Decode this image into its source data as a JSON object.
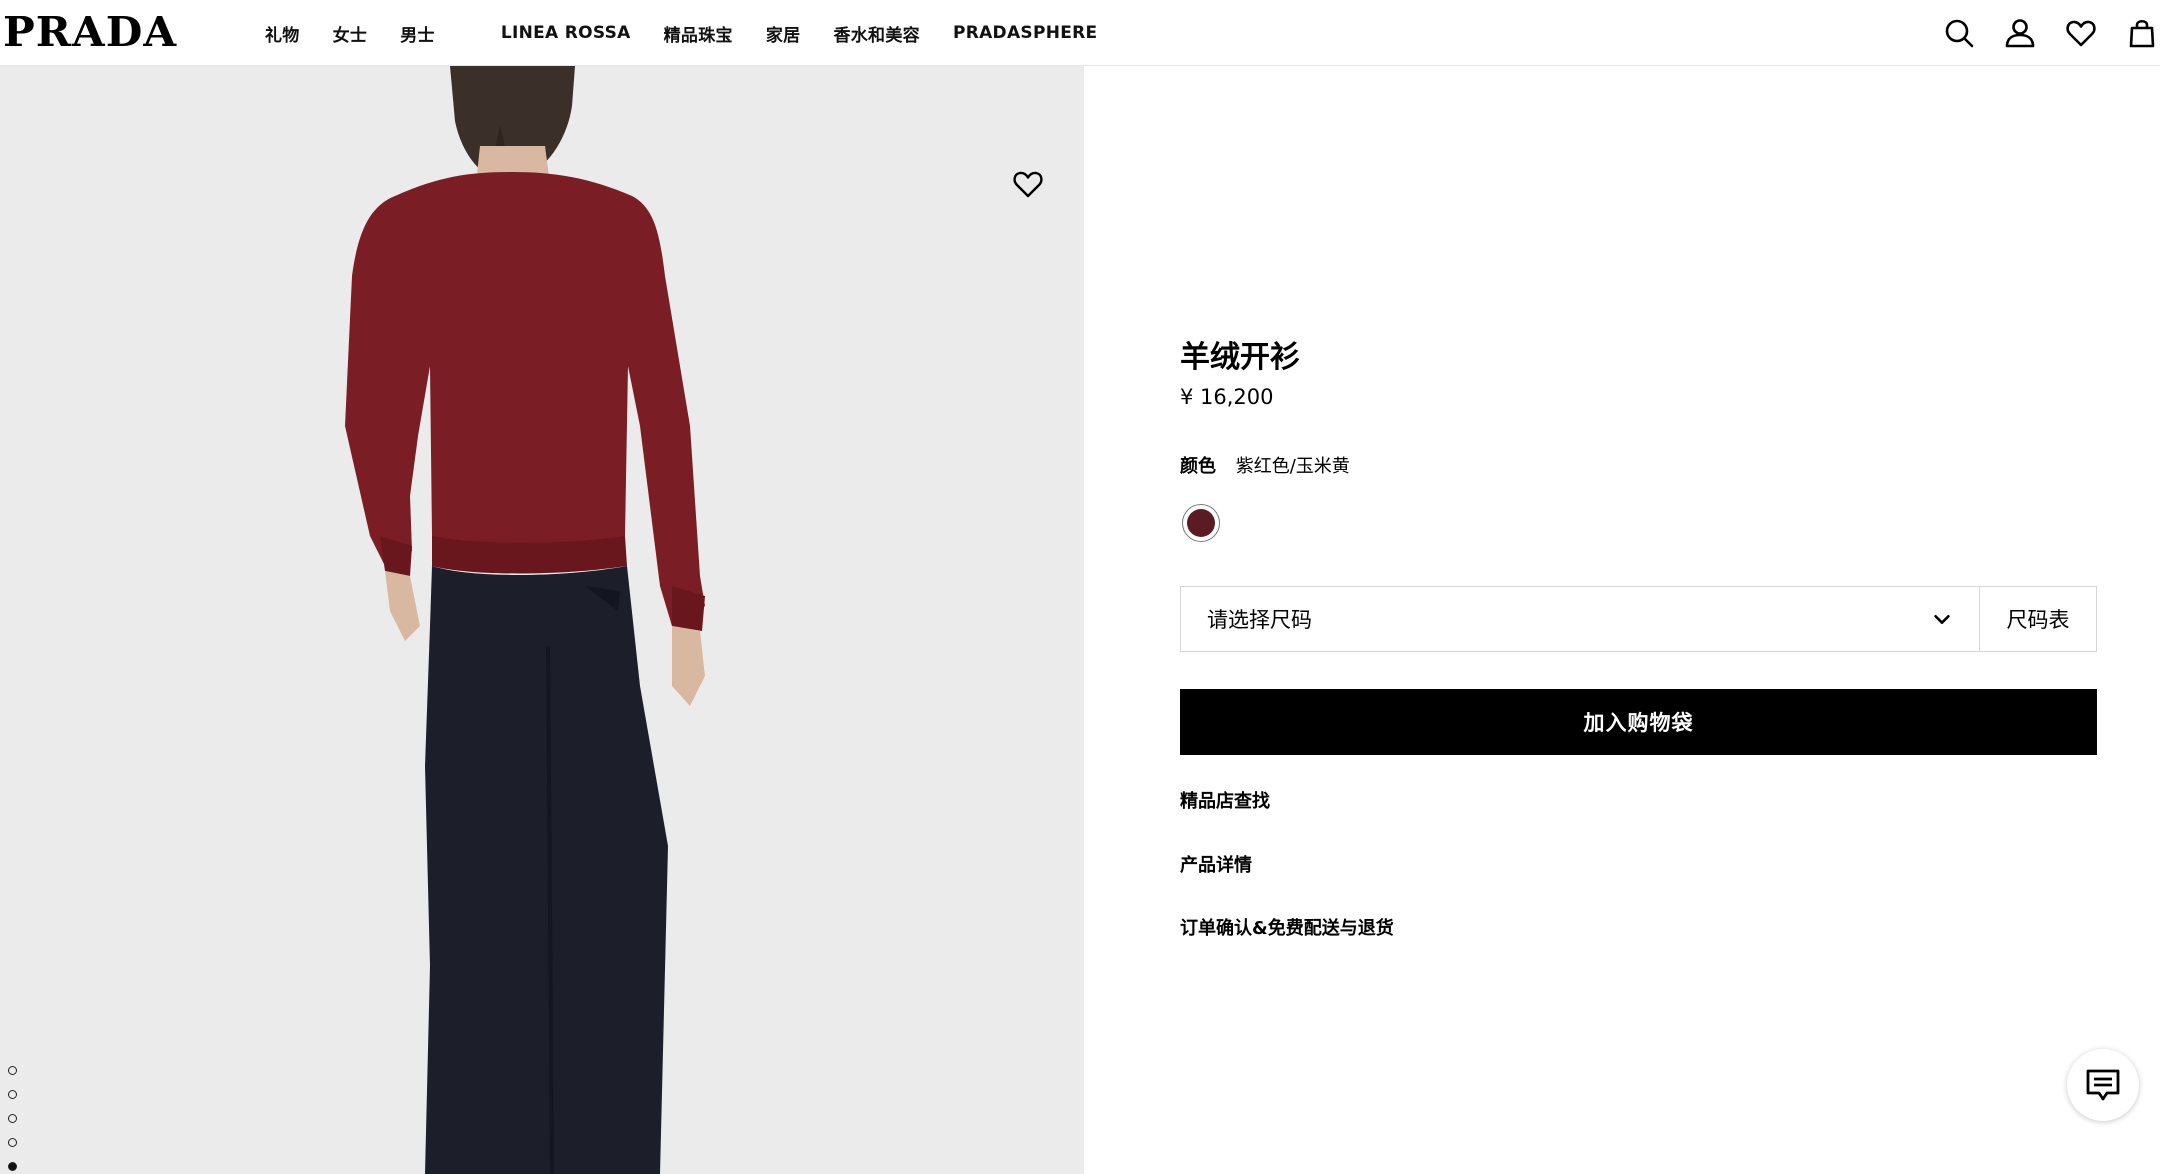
{
  "header": {
    "logo": "PRADA",
    "nav": [
      "礼物",
      "女士",
      "男士",
      "LINEA ROSSA",
      "精品珠宝",
      "家居",
      "香水和美容",
      "PRADASPHERE"
    ]
  },
  "product": {
    "title": "羊绒开衫",
    "price": "¥ 16,200",
    "color_label": "颜色",
    "color_value": "紫红色/玉米黄",
    "swatch_color": "#5c1a22",
    "size_placeholder": "请选择尺码",
    "size_guide": "尺码表",
    "add_to_bag": "加入购物袋",
    "links": [
      "精品店查找",
      "产品详情",
      "订单确认&免费配送与退货"
    ]
  },
  "gallery": {
    "image_count": 6,
    "active_index": 4
  },
  "icons": [
    "search-icon",
    "account-icon",
    "wishlist-icon",
    "bag-icon",
    "heart-icon",
    "chevron-down-icon",
    "chat-icon"
  ]
}
